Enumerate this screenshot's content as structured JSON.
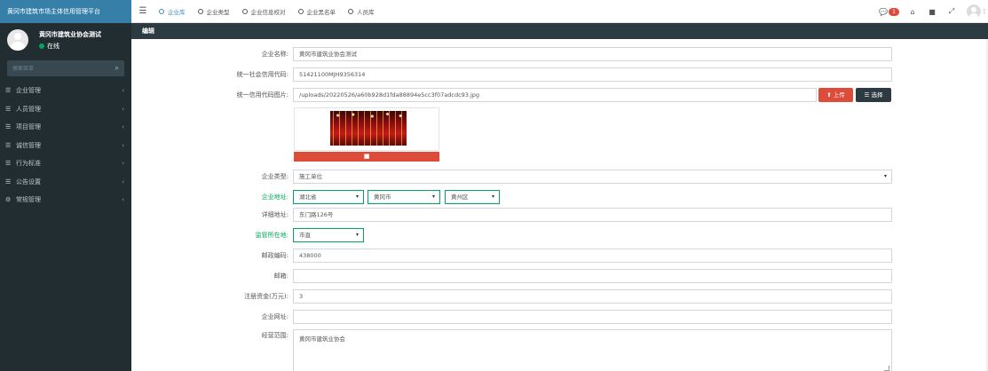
{
  "app": {
    "brand": "黄冈市建筑市场主体信用管理平台",
    "user_name": "黄冈市建筑业协会测试",
    "user_status": "在线",
    "search_placeholder": "搜索菜单"
  },
  "sidebar": {
    "items": [
      {
        "label": "企业管理",
        "icon": "list-icon"
      },
      {
        "label": "人员管理",
        "icon": "list-icon"
      },
      {
        "label": "项目管理",
        "icon": "list-icon"
      },
      {
        "label": "诚信管理",
        "icon": "list-icon"
      },
      {
        "label": "行为标准",
        "icon": "list-icon"
      },
      {
        "label": "公告设置",
        "icon": "list-icon"
      },
      {
        "label": "常规管理",
        "icon": "cogs-icon"
      }
    ]
  },
  "topbar": {
    "tabs": [
      {
        "label": "企业库",
        "active": true
      },
      {
        "label": "企业类型",
        "active": false
      },
      {
        "label": "企业信息校对",
        "active": false
      },
      {
        "label": "企业黑名单",
        "active": false
      },
      {
        "label": "人员库",
        "active": false
      }
    ],
    "message_count": "1"
  },
  "panel": {
    "title": "编辑"
  },
  "form": {
    "company_name": {
      "label": "企业名称:",
      "value": "黄冈市建筑业协会测试"
    },
    "credit_code": {
      "label": "统一社会信用代码:",
      "value": "51421100MJH9356314"
    },
    "credit_image": {
      "label": "统一信用代码图片:",
      "value": "/uploads/20220526/a60b928d1fda88894e5cc3f07adcdc93.jpg",
      "upload_label": "上传",
      "choose_label": "选择"
    },
    "company_type": {
      "label": "企业类型:",
      "value": "施工单位"
    },
    "address": {
      "label": "企业地址:",
      "province": "湖北省",
      "city": "黄冈市",
      "district": "黄州区"
    },
    "detail_address": {
      "label": "详细地址:",
      "value": "东门路126号"
    },
    "supervision": {
      "label": "监管所在地:",
      "value": "市直"
    },
    "postal_code": {
      "label": "邮政编码:",
      "value": "438000"
    },
    "email": {
      "label": "邮箱:",
      "value": ""
    },
    "capital": {
      "label": "注册资金(万元):",
      "value": "3"
    },
    "website": {
      "label": "企业网址:",
      "value": ""
    },
    "scope": {
      "label": "经营范围:",
      "value": "黄冈市建筑业协会"
    }
  },
  "colors": {
    "sidebar_bg": "#222d32",
    "brand_bg": "#367fa9",
    "panel_head_bg": "#2c3b41",
    "danger": "#dd4b39",
    "success": "#00a65a",
    "primary": "#3c8dbc"
  }
}
